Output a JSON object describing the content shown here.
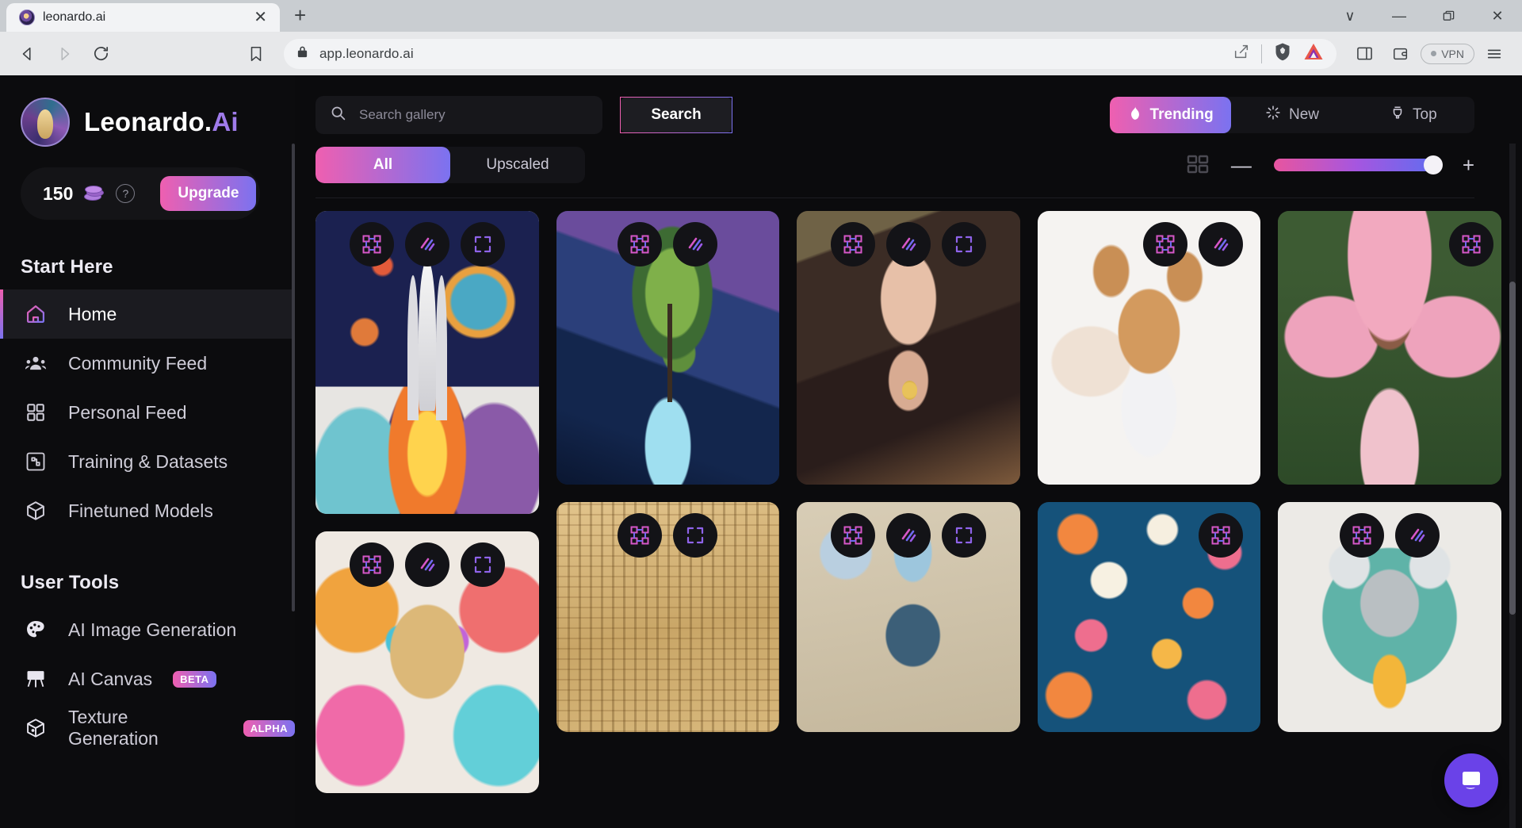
{
  "browser": {
    "tab": {
      "title": "leonardo.ai",
      "favicon_icon": "leonardo-favicon-icon",
      "close_icon": "close-icon"
    },
    "new_tab_label": "+",
    "window_controls": {
      "collapse": "∨",
      "minimize": "—",
      "restore": "❐",
      "close": "✕"
    },
    "nav": {
      "back_icon": "back-arrow-icon",
      "forward_icon": "forward-arrow-icon",
      "reload_icon": "reload-icon",
      "bookmark_icon": "bookmark-icon"
    },
    "url": "app.leonardo.ai",
    "lock_icon": "lock-icon",
    "actions": {
      "share_icon": "share-icon",
      "brave_shields_icon": "brave-lion-shield-icon",
      "brave_rewards_icon": "brave-rewards-triangle-icon",
      "sidebar_icon": "sidebar-panel-icon",
      "wallet_icon": "brave-wallet-icon",
      "vpn_label": "VPN",
      "menu_icon": "hamburger-menu-icon"
    }
  },
  "sidebar": {
    "brand": {
      "name_main": "Leonardo.",
      "name_accent": "Ai",
      "logo_icon": "leonardo-logo-icon"
    },
    "credits": {
      "amount": "150",
      "coin_icon": "credit-coins-icon",
      "help_icon": "help-question-icon",
      "upgrade_label": "Upgrade"
    },
    "sections": [
      {
        "title": "Start Here",
        "items": [
          {
            "label": "Home",
            "icon": "home-icon",
            "active": true,
            "badge": ""
          },
          {
            "label": "Community Feed",
            "icon": "community-people-icon",
            "active": false,
            "badge": ""
          },
          {
            "label": "Personal Feed",
            "icon": "grid-squares-icon",
            "active": false,
            "badge": ""
          },
          {
            "label": "Training & Datasets",
            "icon": "training-chip-icon",
            "active": false,
            "badge": ""
          },
          {
            "label": "Finetuned Models",
            "icon": "cube-box-icon",
            "active": false,
            "badge": ""
          }
        ]
      },
      {
        "title": "User Tools",
        "items": [
          {
            "label": "AI Image Generation",
            "icon": "palette-icon",
            "active": false,
            "badge": ""
          },
          {
            "label": "AI Canvas",
            "icon": "easel-canvas-icon",
            "active": false,
            "badge": "BETA"
          },
          {
            "label": "Texture Generation",
            "icon": "texture-cube-icon",
            "active": false,
            "badge": "ALPHA"
          }
        ]
      }
    ]
  },
  "main": {
    "search": {
      "placeholder": "Search gallery",
      "value": "",
      "icon": "search-icon",
      "button_label": "Search"
    },
    "filters": [
      {
        "label": "All",
        "active": true
      },
      {
        "label": "Upscaled",
        "active": false
      }
    ],
    "sort_tabs": [
      {
        "label": "Trending",
        "icon": "flame-icon",
        "active": true
      },
      {
        "label": "New",
        "icon": "sparkle-icon",
        "active": false
      },
      {
        "label": "Top",
        "icon": "trophy-icon",
        "active": false
      }
    ],
    "zoom_controls": {
      "grid_icon": "layout-grid-icon",
      "minus_label": "—",
      "plus_label": "+",
      "slider_value": 100
    },
    "gallery": {
      "card_actions": {
        "remix_icon": "remix-grid-icon",
        "upscale_icon": "upscale-lines-icon",
        "expand_icon": "expand-arrows-icon"
      },
      "columns": [
        {
          "cards": [
            {
              "alt": "space shuttle rocket launch illustration",
              "art": "art-rocket",
              "actions": [
                "remix",
                "upscale",
                "expand"
              ]
            },
            {
              "alt": "colorful lion with sunglasses watercolor",
              "art": "art-lion",
              "actions": [
                "remix",
                "upscale",
                "expand"
              ]
            }
          ]
        },
        {
          "cards": [
            {
              "alt": "cosmic tree over waterfall fantasy landscape",
              "art": "art-tree",
              "actions": [
                "remix",
                "upscale"
              ]
            },
            {
              "alt": "egyptian papyrus hieroglyphs",
              "art": "art-papyrus",
              "actions": [
                "remix",
                "expand"
              ]
            }
          ]
        },
        {
          "cards": [
            {
              "alt": "portrait of woman with gold necklace",
              "art": "art-woman",
              "actions": [
                "remix",
                "upscale",
                "expand"
              ]
            },
            {
              "alt": "blue haired warrior character sheet",
              "art": "art-warrior",
              "actions": [
                "remix",
                "upscale",
                "expand"
              ]
            }
          ]
        },
        {
          "cards": [
            {
              "alt": "chihuahua dog watercolor portrait",
              "art": "art-dog",
              "actions": [
                "remix",
                "upscale"
              ]
            },
            {
              "alt": "floral pattern on blue background",
              "art": "art-floral",
              "actions": [
                "remix"
              ]
            }
          ]
        },
        {
          "cards": [
            {
              "alt": "fairy woman with pink curly hair",
              "art": "art-fairy",
              "actions": [
                "remix"
              ]
            },
            {
              "alt": "koala riding a bicycle illustration",
              "art": "art-koala",
              "actions": [
                "remix",
                "upscale"
              ]
            }
          ]
        }
      ]
    },
    "support_bubble_icon": "intercom-chat-icon"
  },
  "colors": {
    "accent_pink": "#ef5fb0",
    "accent_purple": "#7b72f0",
    "bg_dark": "#0b0b0d",
    "panel": "#141418",
    "intercom": "#6a42e8"
  }
}
